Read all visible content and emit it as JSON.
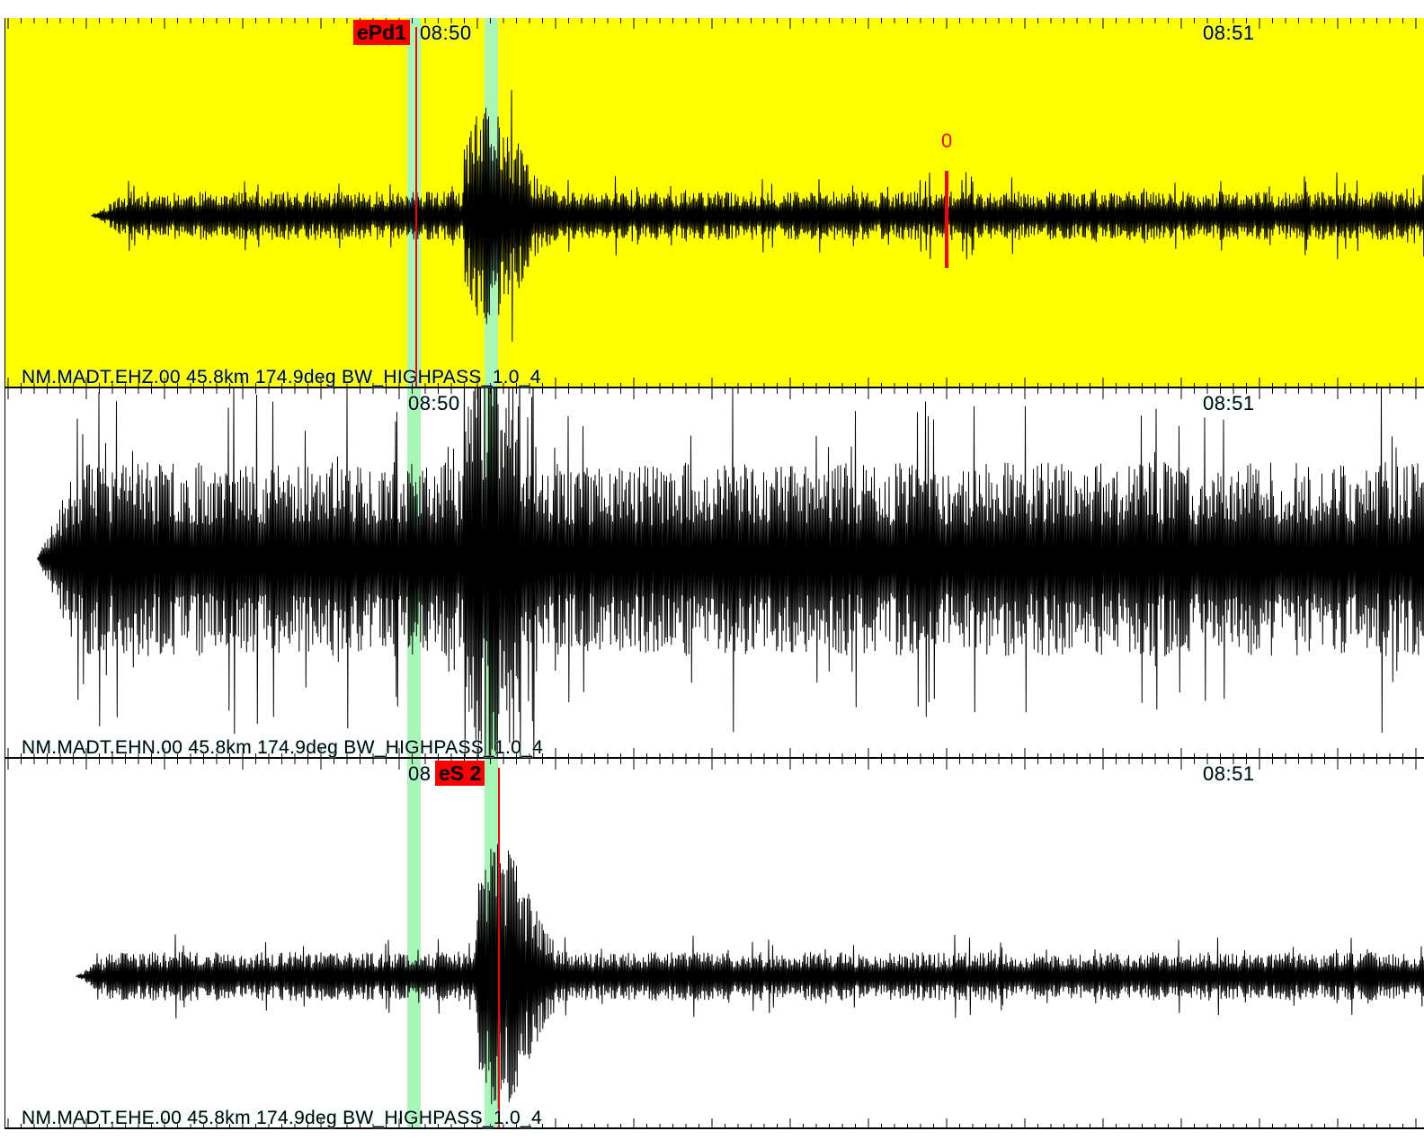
{
  "colors": {
    "selected_background": "#ffff00",
    "background": "#ffffff",
    "trace": "#000000",
    "window_band": "#a8f5b8",
    "pick": "#ff0000",
    "label_halo": "#bff7f3"
  },
  "panels": [
    {
      "id": "ehz",
      "selected": true,
      "channel_label": "NM.MADT.EHZ.00 45.8km 174.9deg BW_HIGHPASS_1.0_4",
      "time_labels": [
        "08:50",
        "08:51"
      ],
      "pick": {
        "label": "ePd1"
      },
      "amplitude_marker": {
        "label": "0"
      },
      "signal": {
        "noise_level": 0.15,
        "event_peak": 0.55
      }
    },
    {
      "id": "ehn",
      "selected": false,
      "channel_label": "NM.MADT.EHN.00 45.8km 174.9deg BW_HIGHPASS_1.0_4",
      "time_labels": [
        "08:50",
        "08:51"
      ],
      "signal": {
        "noise_level": 0.6,
        "event_peak": 0.8
      }
    },
    {
      "id": "ehe",
      "selected": false,
      "channel_label": "NM.MADT.EHE.00 45.8km 174.9deg BW_HIGHPASS_1.0_4",
      "time_labels": [
        "08",
        "08:51"
      ],
      "pick": {
        "label": "eS 2"
      },
      "signal": {
        "noise_level": 0.15,
        "event_peak": 0.7
      }
    }
  ]
}
